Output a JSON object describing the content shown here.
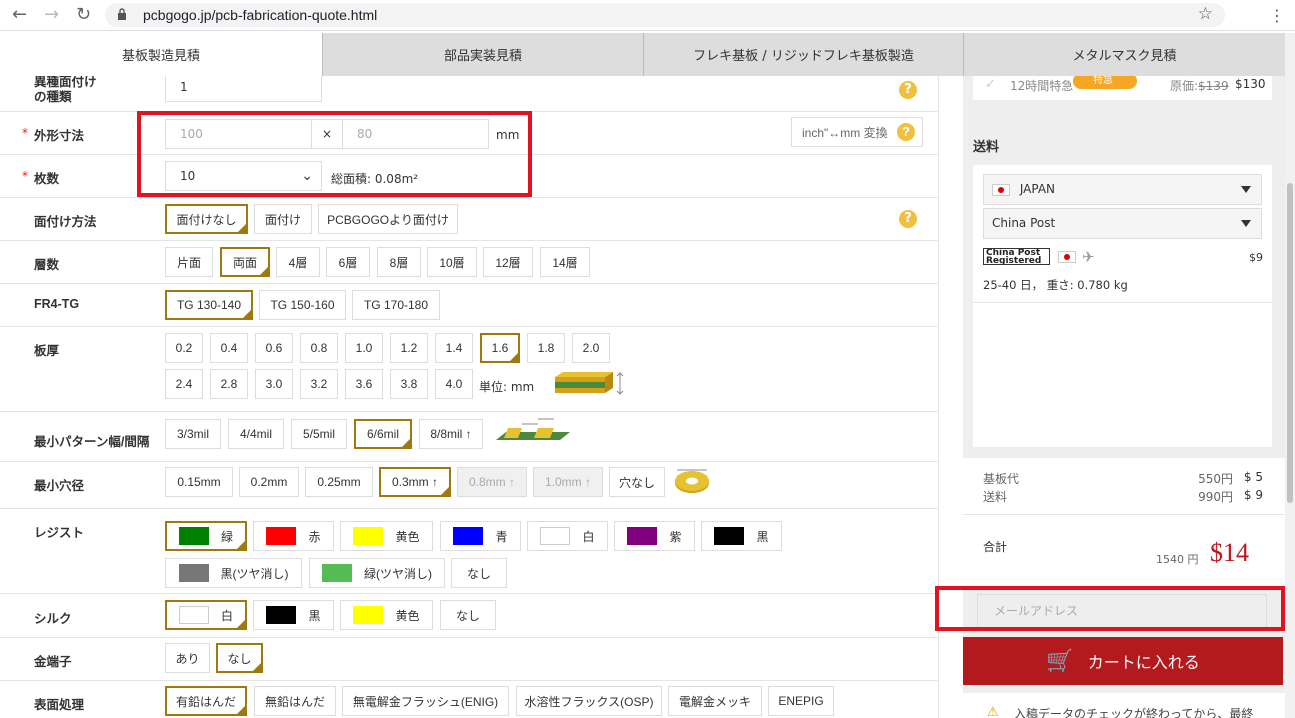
{
  "browser": {
    "url": "pcbgogo.jp/pcb-fabrication-quote.html"
  },
  "tabs": [
    {
      "label": "基板製造見積",
      "active": true
    },
    {
      "label": "部品実装見積",
      "active": false
    },
    {
      "label": "フレキ基板 / リジッドフレキ基板製造",
      "active": false
    },
    {
      "label": "メタルマスク見積",
      "active": false
    }
  ],
  "form": {
    "panelization_types": {
      "label_line1": "異種面付け",
      "label_line2": "の種類",
      "value": "1"
    },
    "dimensions": {
      "label": "外形寸法",
      "required_mark": "*",
      "x_placeholder": "100",
      "y_placeholder": "80",
      "times": "×",
      "unit": "mm",
      "convert_button": "inch\"↔mm 変換"
    },
    "quantity": {
      "label": "枚数",
      "required_mark": "*",
      "value": "10",
      "total_area": "総面積: 0.08m²"
    },
    "panel_method": {
      "label": "面付け方法",
      "options": [
        "面付けなし",
        "面付け",
        "PCBGOGOより面付け"
      ],
      "selected": "面付けなし"
    },
    "layers": {
      "label": "層数",
      "options": [
        "片面",
        "両面",
        "4層",
        "6層",
        "8層",
        "10層",
        "12層",
        "14層"
      ],
      "selected": "両面"
    },
    "fr4_tg": {
      "label": "FR4-TG",
      "options": [
        "TG 130-140",
        "TG 150-160",
        "TG 170-180"
      ],
      "selected": "TG 130-140"
    },
    "thickness": {
      "label": "板厚",
      "row1": [
        "0.2",
        "0.4",
        "0.6",
        "0.8",
        "1.0",
        "1.2",
        "1.4",
        "1.6",
        "1.8",
        "2.0"
      ],
      "row2": [
        "2.4",
        "2.8",
        "3.0",
        "3.2",
        "3.6",
        "3.8",
        "4.0"
      ],
      "selected": "1.6",
      "unit": "単位: mm"
    },
    "trace": {
      "label": "最小パターン幅/間隔",
      "options": [
        "3/3mil",
        "4/4mil",
        "5/5mil",
        "6/6mil",
        "8/8mil ↑"
      ],
      "selected": "6/6mil"
    },
    "hole": {
      "label": "最小穴径",
      "options": [
        "0.15mm",
        "0.2mm",
        "0.25mm",
        "0.3mm ↑",
        "0.8mm ↑",
        "1.0mm ↑",
        "穴なし"
      ],
      "selected": "0.3mm ↑",
      "disabled": [
        "0.8mm ↑",
        "1.0mm ↑"
      ]
    },
    "resist": {
      "label": "レジスト",
      "options": [
        {
          "name": "緑",
          "color": "#008000"
        },
        {
          "name": "赤",
          "color": "#ff0000"
        },
        {
          "name": "黄色",
          "color": "#ffff00"
        },
        {
          "name": "青",
          "color": "#0000ff"
        },
        {
          "name": "白",
          "color": "#ffffff"
        },
        {
          "name": "紫",
          "color": "#800080"
        },
        {
          "name": "黒",
          "color": "#000000"
        },
        {
          "name": "黒(ツヤ消し)",
          "color": "#777777"
        },
        {
          "name": "緑(ツヤ消し)",
          "color": "#55bb55"
        },
        {
          "name": "なし",
          "color": ""
        }
      ],
      "selected": "緑"
    },
    "silk": {
      "label": "シルク",
      "options": [
        {
          "name": "白",
          "color": "#ffffff"
        },
        {
          "name": "黒",
          "color": "#000000"
        },
        {
          "name": "黄色",
          "color": "#ffff00"
        },
        {
          "name": "なし",
          "color": ""
        }
      ],
      "selected": "白"
    },
    "gold_fingers": {
      "label": "金端子",
      "options": [
        "あり",
        "なし"
      ],
      "selected": "なし"
    },
    "finish": {
      "label": "表面処理",
      "options": [
        "有鉛はんだ",
        "無鉛はんだ",
        "無電解金フラッシュ(ENIG)",
        "水溶性フラックス(OSP)",
        "電解金メッキ",
        "ENEPIG"
      ],
      "selected": "有鉛はんだ"
    }
  },
  "side": {
    "express": {
      "label": "12時間特急",
      "badge": "特急",
      "orig_label": "原価:",
      "orig_price": "$139",
      "price": "$130"
    },
    "shipping": {
      "title": "送料",
      "country": "JAPAN",
      "method": "China Post",
      "carrier_logo": "China Post Registered Air",
      "cost": "$9",
      "eta": "25-40 日， 重さ: 0.780 kg"
    },
    "summary": {
      "rows": [
        {
          "label": "基板代",
          "yen": "550円",
          "usd": "$ 5"
        },
        {
          "label": "送料",
          "yen": "990円",
          "usd": "$ 9"
        }
      ],
      "total_label": "合計",
      "total_yen": "1540 円",
      "total_usd": "$14"
    },
    "email_placeholder": "メールアドレス",
    "cart_button": "カートに入れる",
    "notice": "入稿データのチェックが終わってから、最終"
  }
}
